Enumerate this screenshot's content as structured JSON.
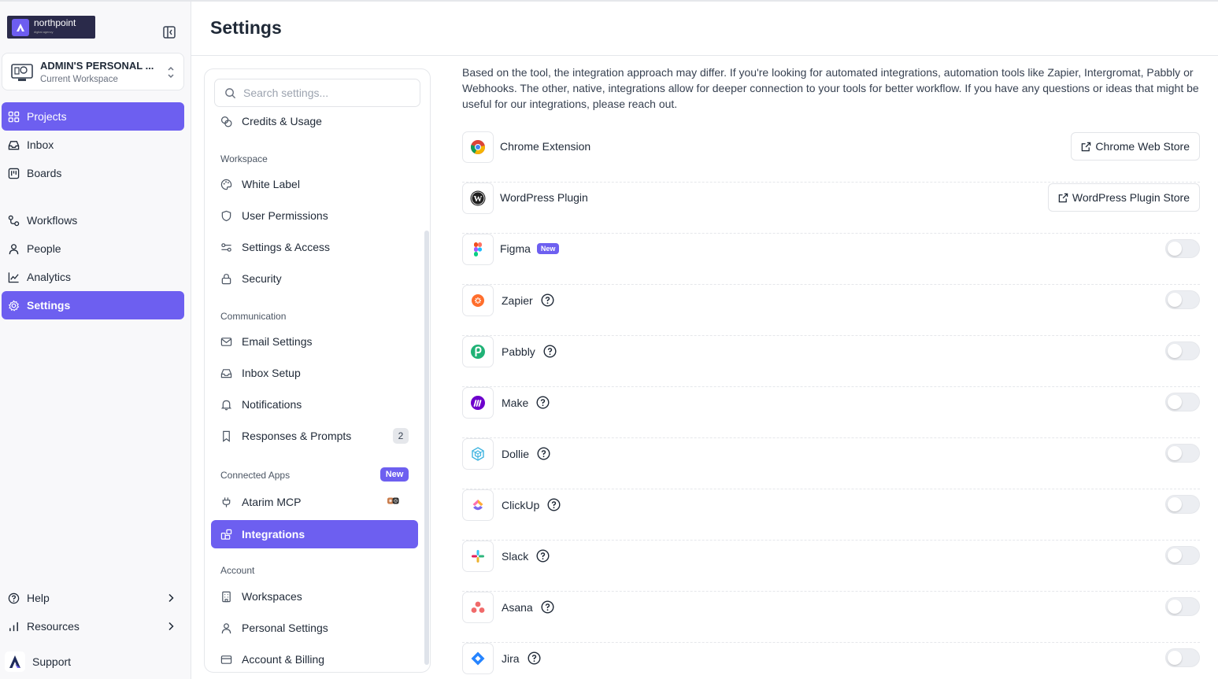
{
  "app": {
    "logo_text": "northpoint",
    "logo_sub": "digital agency",
    "page_title": "Settings"
  },
  "workspace": {
    "name": "ADMIN'S PERSONAL ...",
    "subtitle": "Current Workspace"
  },
  "nav": {
    "items": [
      {
        "label": "Projects",
        "icon": "grid-icon",
        "active": true
      },
      {
        "label": "Inbox",
        "icon": "inbox-icon"
      },
      {
        "label": "Boards",
        "icon": "board-icon"
      },
      {
        "label": "Workflows",
        "icon": "workflow-icon"
      },
      {
        "label": "People",
        "icon": "person-icon"
      },
      {
        "label": "Analytics",
        "icon": "chart-icon"
      },
      {
        "label": "Settings",
        "icon": "gear-icon",
        "active": true
      }
    ],
    "bottom": [
      {
        "label": "Help",
        "icon": "help-circle-icon"
      },
      {
        "label": "Resources",
        "icon": "bar-chart-icon"
      },
      {
        "label": "Support",
        "icon": "support-logo"
      }
    ]
  },
  "settings_panel": {
    "search_placeholder": "Search settings...",
    "items": {
      "credits": "Credits & Usage",
      "workspace_head": "Workspace",
      "white_label": "White Label",
      "user_permissions": "User Permissions",
      "settings_access": "Settings & Access",
      "security": "Security",
      "communication_head": "Communication",
      "email_settings": "Email Settings",
      "inbox_setup": "Inbox Setup",
      "notifications": "Notifications",
      "responses_prompts": "Responses & Prompts",
      "responses_count": "2",
      "connected_apps_head": "Connected Apps",
      "connected_apps_badge": "New",
      "atarim_mcp": "Atarim MCP",
      "integrations": "Integrations",
      "account_head": "Account",
      "workspaces": "Workspaces",
      "personal_settings": "Personal Settings",
      "account_billing": "Account & Billing"
    }
  },
  "main": {
    "intro": "Based on the tool, the integration approach may differ. If you're looking for automated integrations, automation tools like Zapier, Intergromat, Pabbly or Webhooks. The other, native, integrations allow for deeper connection to your tools for better workflow. If you have any questions or ideas that might be useful for our integrations, please reach out.",
    "integrations": [
      {
        "name": "Chrome Extension",
        "icon": "chrome-icon",
        "action": "Chrome Web Store"
      },
      {
        "name": "WordPress Plugin",
        "icon": "wordpress-icon",
        "action": "WordPress Plugin Store"
      },
      {
        "name": "Figma",
        "icon": "figma-icon",
        "badge": "New",
        "enabled": false
      },
      {
        "name": "Zapier",
        "icon": "zapier-icon",
        "enabled": false
      },
      {
        "name": "Pabbly",
        "icon": "pabbly-icon",
        "enabled": false
      },
      {
        "name": "Make",
        "icon": "make-icon",
        "enabled": false
      },
      {
        "name": "Dollie",
        "icon": "dollie-icon",
        "enabled": false
      },
      {
        "name": "ClickUp",
        "icon": "clickup-icon",
        "enabled": false
      },
      {
        "name": "Slack",
        "icon": "slack-icon",
        "enabled": false
      },
      {
        "name": "Asana",
        "icon": "asana-icon",
        "enabled": false
      },
      {
        "name": "Jira",
        "icon": "jira-icon",
        "enabled": false
      }
    ]
  },
  "colors": {
    "accent": "#6d5ff0",
    "border": "#e5e7eb",
    "sidebar_bg": "#f8f8fa"
  }
}
